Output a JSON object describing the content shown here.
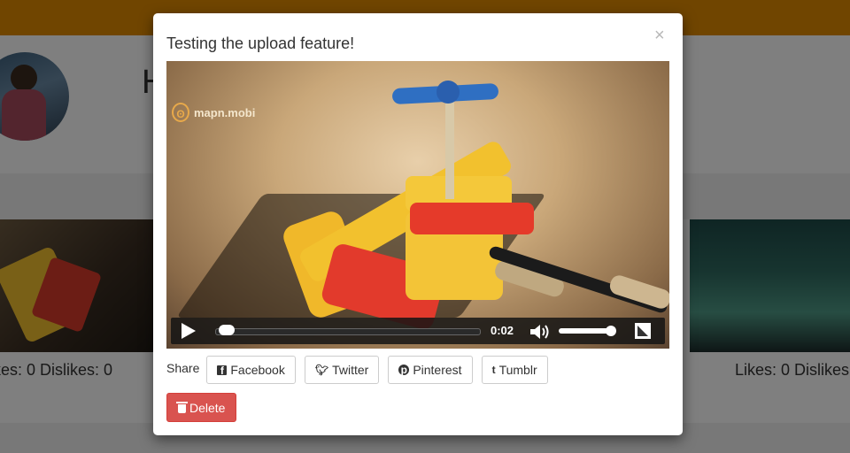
{
  "background": {
    "heading_fragment": "H",
    "left_card_stats": "kes: 0 Dislikes: 0",
    "right_card_stats": "Likes: 0 Dislikes",
    "topbar_color": "#e08a00"
  },
  "modal": {
    "title": "Testing the upload feature!",
    "close_symbol": "×",
    "video": {
      "watermark": "mapn.mobi",
      "elapsed_time": "0:02",
      "progress_fraction": 0.02,
      "volume_fraction": 0.95
    },
    "share": {
      "label": "Share",
      "buttons": [
        {
          "label": "Facebook",
          "icon": "facebook-icon"
        },
        {
          "label": "Twitter",
          "icon": "twitter-icon"
        },
        {
          "label": "Pinterest",
          "icon": "pinterest-icon"
        },
        {
          "label": "Tumblr",
          "icon": "tumblr-icon"
        }
      ]
    },
    "delete_label": "Delete",
    "delete_color": "#d9534f"
  }
}
